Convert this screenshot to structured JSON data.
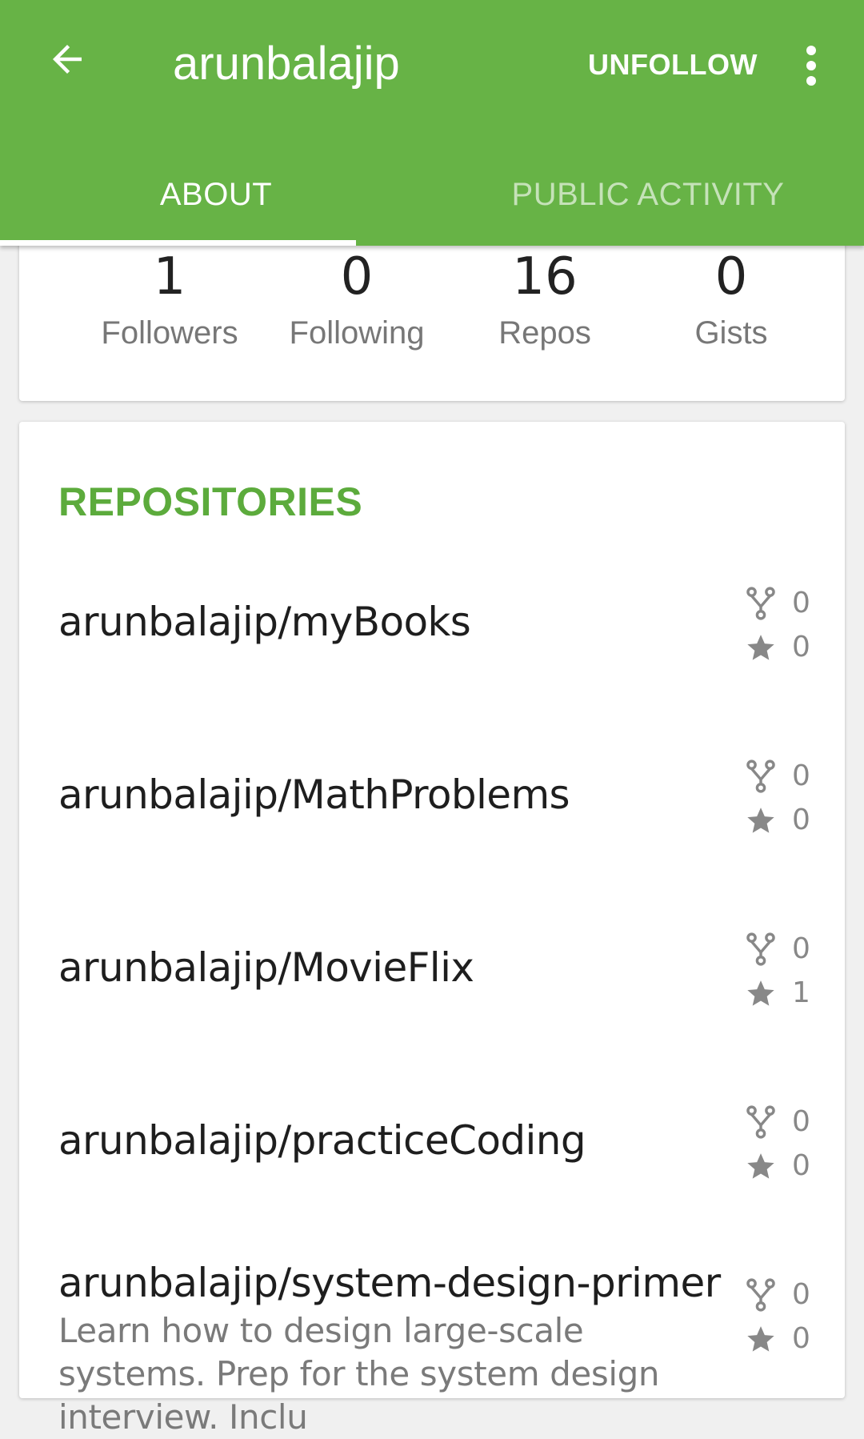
{
  "appbar": {
    "back_icon": "arrow-back-icon",
    "title": "arunbalajip",
    "unfollow_label": "UNFOLLOW",
    "more_icon": "more-vert-icon",
    "background": "#67b346"
  },
  "tabs": [
    {
      "label": "ABOUT",
      "active": true
    },
    {
      "label": "PUBLIC ACTIVITY",
      "active": false
    }
  ],
  "stats": [
    {
      "value": "1",
      "label": "Followers"
    },
    {
      "value": "0",
      "label": "Following"
    },
    {
      "value": "16",
      "label": "Repos"
    },
    {
      "value": "0",
      "label": "Gists"
    }
  ],
  "repositories": {
    "title": "REPOSITORIES",
    "title_color": "#5cab3c",
    "items": [
      {
        "name": "arunbalajip/myBooks",
        "description": "",
        "forks": "0",
        "stars": "0"
      },
      {
        "name": "arunbalajip/MathProblems",
        "description": "",
        "forks": "0",
        "stars": "0"
      },
      {
        "name": "arunbalajip/MovieFlix",
        "description": "",
        "forks": "0",
        "stars": "1"
      },
      {
        "name": "arunbalajip/practiceCoding",
        "description": "",
        "forks": "0",
        "stars": "0"
      },
      {
        "name": "arunbalajip/system-design-primer",
        "description": "Learn how to design large-scale systems. Prep for the system design interview.  Inclu",
        "forks": "0",
        "stars": "0"
      }
    ]
  },
  "icons": {
    "fork": "fork-icon",
    "star": "star-icon"
  }
}
